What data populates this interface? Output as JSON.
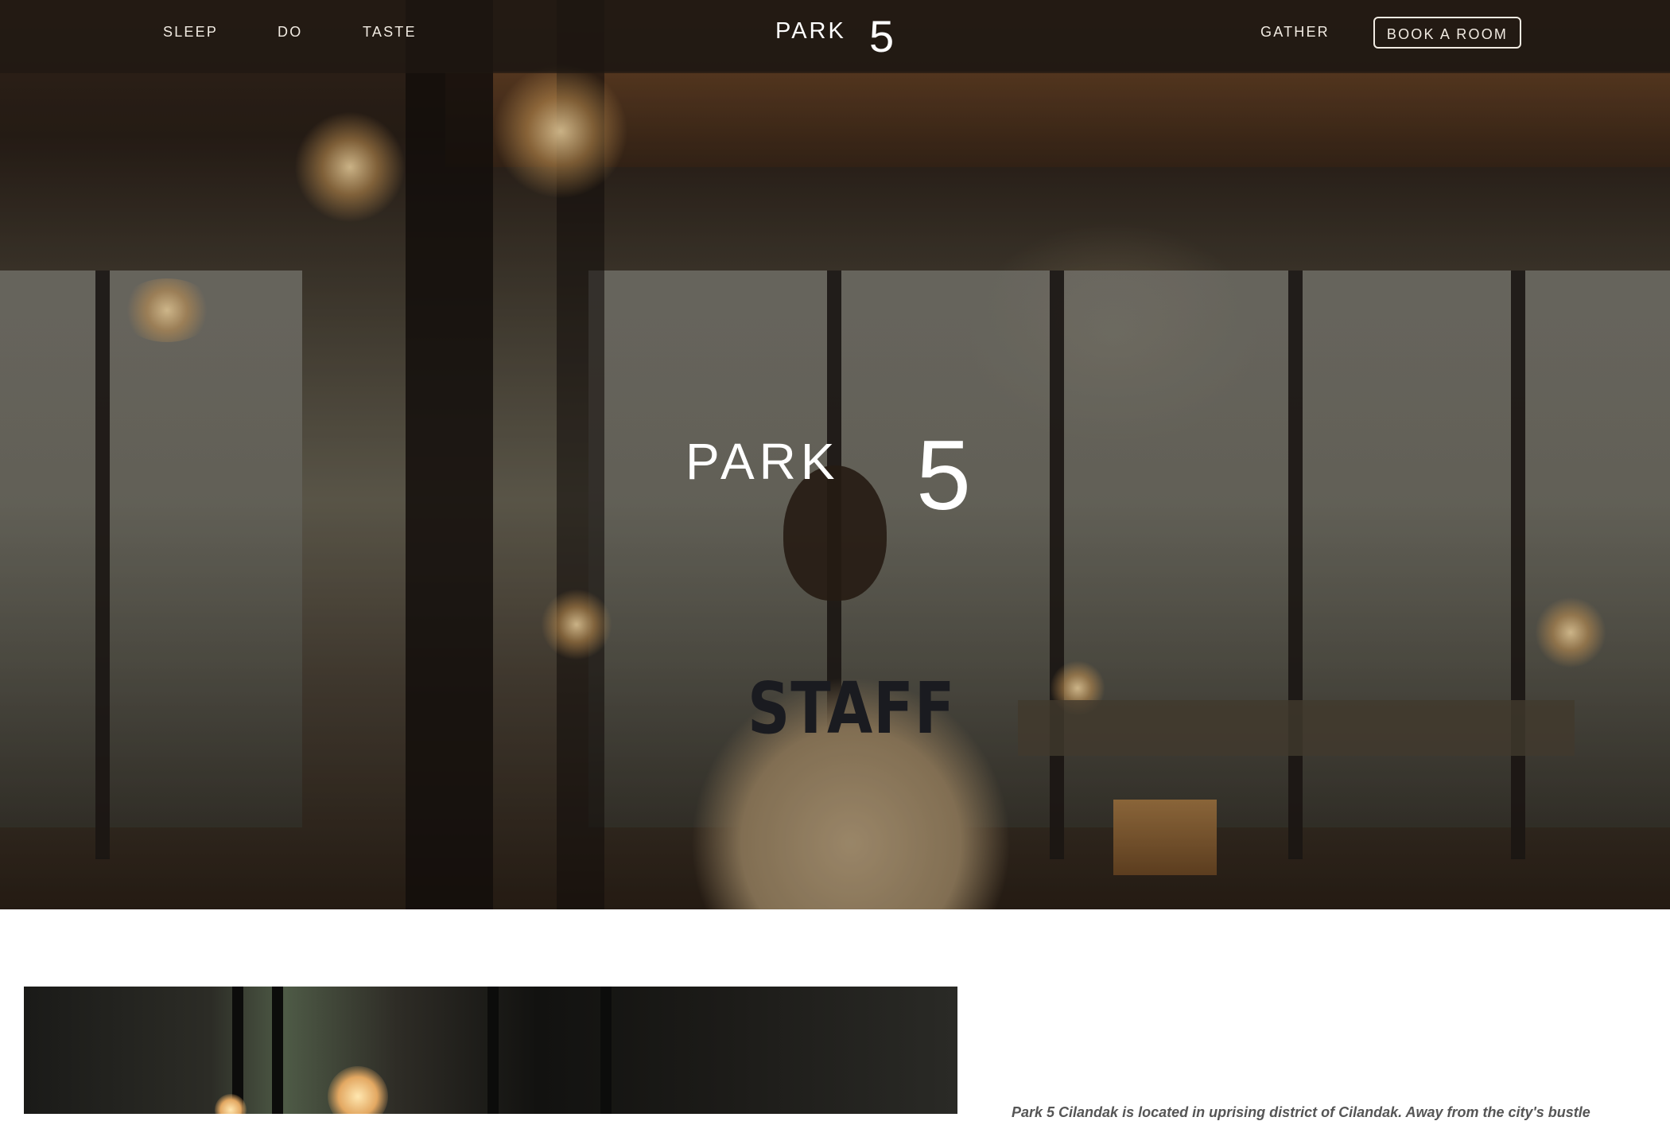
{
  "nav": {
    "left_links": [
      "SLEEP",
      "DO",
      "TASTE"
    ],
    "right_link": "GATHER",
    "book_label": "BOOK A ROOM",
    "logo_word": "PARK",
    "logo_number": "5"
  },
  "hero": {
    "logo_word": "PARK",
    "logo_number": "5",
    "shirt_text": "STAFF"
  },
  "intro": {
    "text": "Park 5 Cilandak is located in uprising district of Cilandak. Away from the city's bustle"
  },
  "colors": {
    "nav_bg": "#1e1812",
    "nav_text": "#f1ebe2",
    "page_bg": "#ffffff"
  }
}
